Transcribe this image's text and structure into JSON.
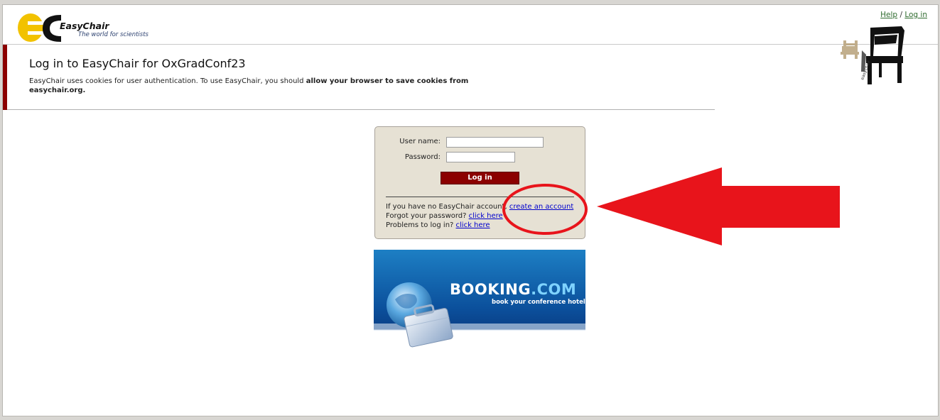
{
  "header": {
    "logo_name": "EasyChair",
    "logo_tagline": "The world for scientists",
    "help_link": "Help",
    "separator": "/",
    "login_link": "Log in"
  },
  "page": {
    "title": "Log in to EasyChair for OxGradConf23",
    "notice_plain": "EasyChair uses cookies for user authentication. To use EasyChair, you should ",
    "notice_bold": "allow your browser to save cookies from easychair.org."
  },
  "login_form": {
    "username_label": "User name:",
    "username_value": "",
    "password_label": "Password:",
    "password_value": "",
    "submit_label": "Log in",
    "no_account_text": "If you have no EasyChair account, ",
    "create_account_link": "create an account",
    "forgot_text": "Forgot your password? ",
    "forgot_link": "click here",
    "problems_text": "Problems to log in? ",
    "problems_link": "click here"
  },
  "ad": {
    "brand_main": "BOOKING",
    "brand_suffix": ".COM",
    "tagline": "book your conference hotel"
  },
  "colors": {
    "accent_red": "#8b0000",
    "link_blue": "#0000cc",
    "annotation_red": "#e8141b",
    "login_box_bg": "#e6e1d4"
  }
}
